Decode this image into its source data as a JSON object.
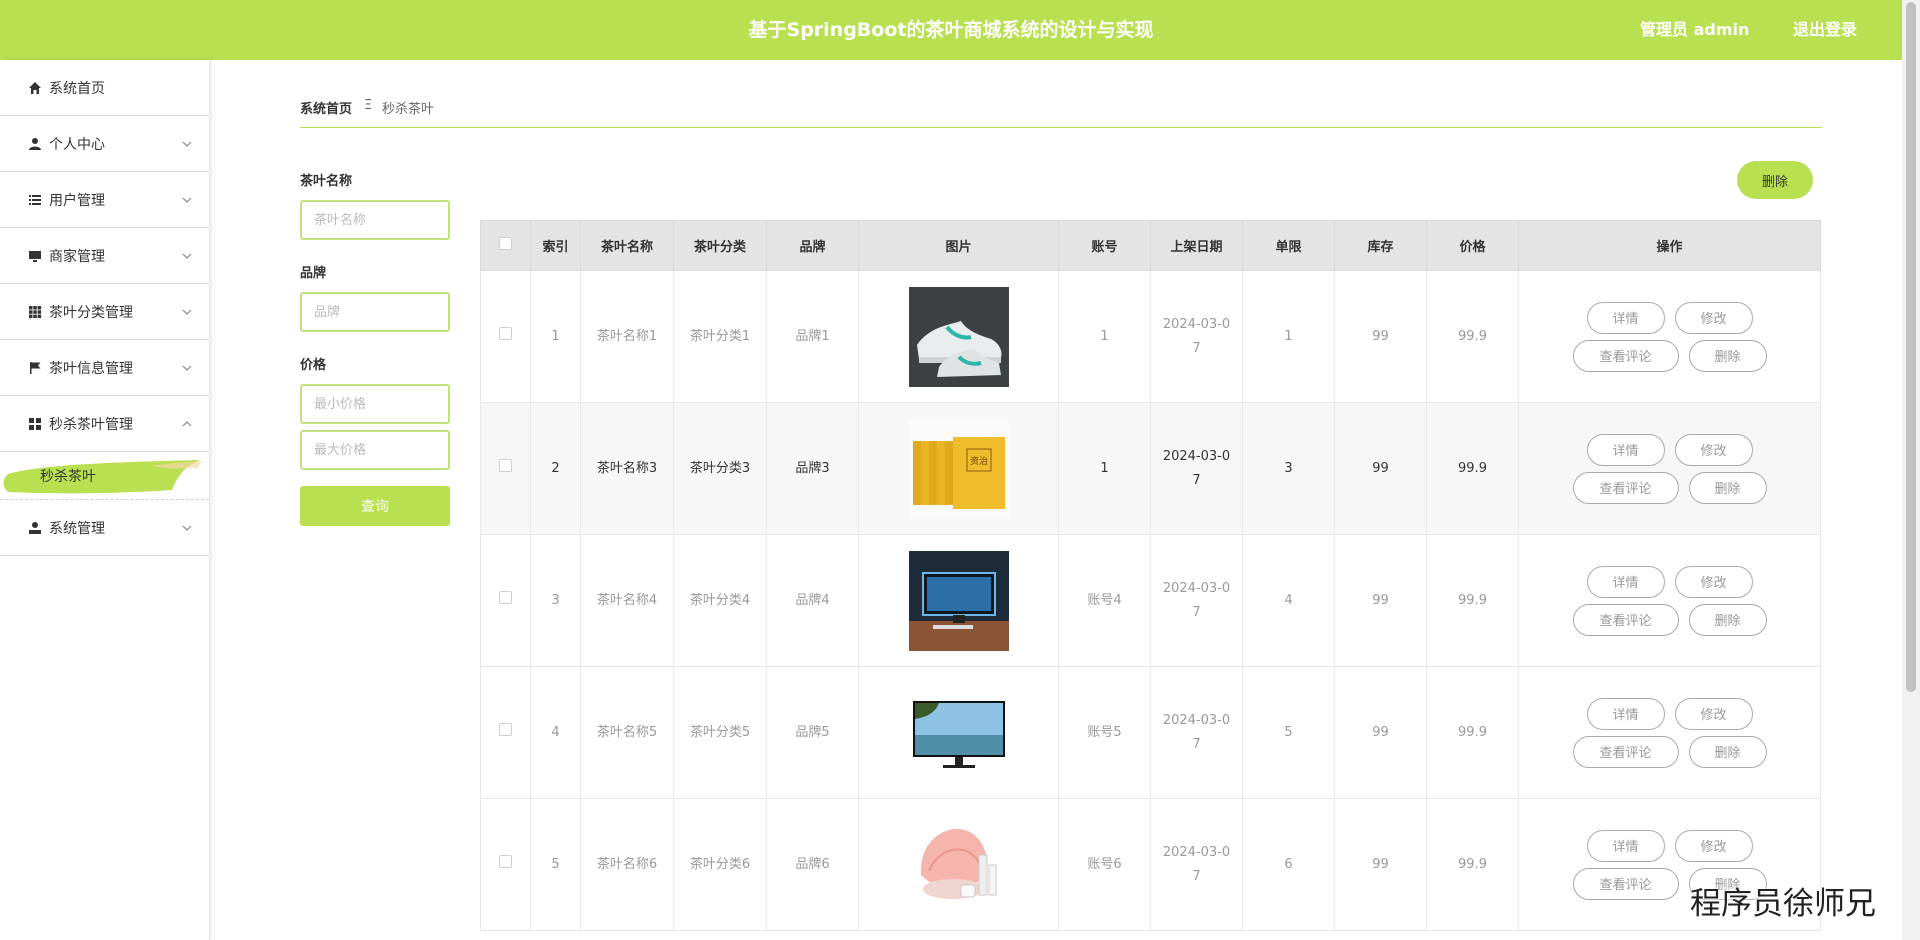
{
  "header": {
    "title": "基于SpringBoot的茶叶商城系统的设计与实现",
    "user": "管理员 admin",
    "logout": "退出登录"
  },
  "sidebar": {
    "items": [
      {
        "label": "系统首页",
        "icon": "home-icon"
      },
      {
        "label": "个人中心",
        "icon": "user-icon"
      },
      {
        "label": "用户管理",
        "icon": "list-icon"
      },
      {
        "label": "商家管理",
        "icon": "monitor-icon"
      },
      {
        "label": "茶叶分类管理",
        "icon": "grid-icon"
      },
      {
        "label": "茶叶信息管理",
        "icon": "flag-icon"
      },
      {
        "label": "秒杀茶叶管理",
        "icon": "apps-icon"
      },
      {
        "label": "系统管理",
        "icon": "admin-icon"
      }
    ],
    "active_sub": "秒杀茶叶"
  },
  "breadcrumb": {
    "home": "系统首页",
    "sep": "Ξ",
    "current": "秒杀茶叶"
  },
  "search": {
    "name_label": "茶叶名称",
    "name_placeholder": "茶叶名称",
    "brand_label": "品牌",
    "brand_placeholder": "品牌",
    "price_label": "价格",
    "min_placeholder": "最小价格",
    "max_placeholder": "最大价格",
    "query": "查询"
  },
  "toolbar": {
    "delete": "删除"
  },
  "table": {
    "headers": [
      "索引",
      "茶叶名称",
      "茶叶分类",
      "品牌",
      "图片",
      "账号",
      "上架日期",
      "单限",
      "库存",
      "价格",
      "操作"
    ],
    "rows": [
      {
        "index": "1",
        "name": "茶叶名称1",
        "category": "茶叶分类1",
        "brand": "品牌1",
        "image": "sneaker",
        "account": "1",
        "date_a": "2024-03-0",
        "date_b": "7",
        "limit": "1",
        "stock": "99",
        "price": "99.9"
      },
      {
        "index": "2",
        "name": "茶叶名称3",
        "category": "茶叶分类3",
        "brand": "品牌3",
        "image": "book-set",
        "account": "1",
        "date_a": "2024-03-0",
        "date_b": "7",
        "limit": "3",
        "stock": "99",
        "price": "99.9"
      },
      {
        "index": "3",
        "name": "茶叶名称4",
        "category": "茶叶分类4",
        "brand": "品牌4",
        "image": "monitor-desk",
        "account": "账号4",
        "date_a": "2024-03-0",
        "date_b": "7",
        "limit": "4",
        "stock": "99",
        "price": "99.9"
      },
      {
        "index": "4",
        "name": "茶叶名称5",
        "category": "茶叶分类5",
        "brand": "品牌5",
        "image": "monitor",
        "account": "账号5",
        "date_a": "2024-03-0",
        "date_b": "7",
        "limit": "5",
        "stock": "99",
        "price": "99.9"
      },
      {
        "index": "5",
        "name": "茶叶名称6",
        "category": "茶叶分类6",
        "brand": "品牌6",
        "image": "cosmetics",
        "account": "账号6",
        "date_a": "2024-03-0",
        "date_b": "7",
        "limit": "6",
        "stock": "99",
        "price": "99.9"
      }
    ],
    "ops": {
      "detail": "详情",
      "edit": "修改",
      "comments": "查看评论",
      "delete": "删除"
    }
  },
  "watermark": "程序员徐师兄",
  "colors": {
    "accent": "#b9e051",
    "accent_border": "#c2e07c"
  }
}
